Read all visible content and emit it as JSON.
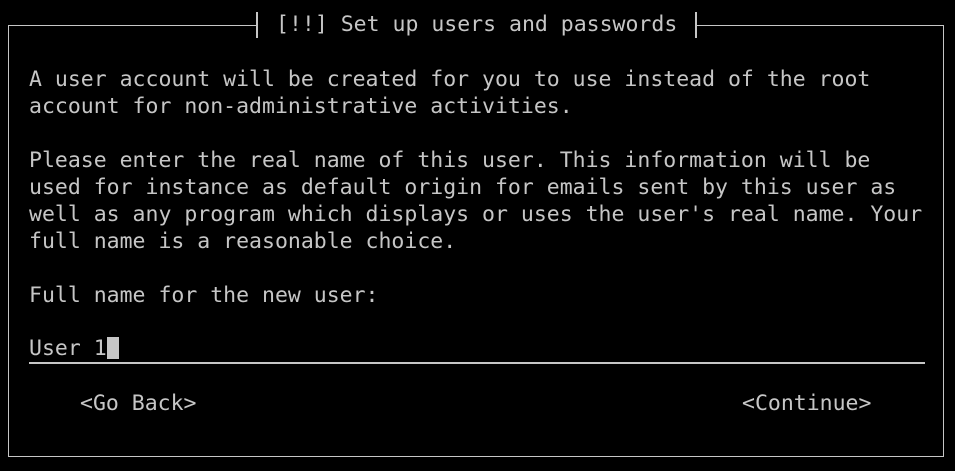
{
  "dialog": {
    "title": "[!!] Set up users and passwords",
    "paragraphs": [
      "A user account will be created for you to use instead of the root",
      "account for non-administrative activities.",
      "Please enter the real name of this user. This information will be",
      "used for instance as default origin for emails sent by this user as",
      "well as any program which displays or uses the user's real name. Your",
      "full name is a reasonable choice."
    ],
    "prompt": "Full name for the new user:",
    "input_value": "User 1"
  },
  "buttons": {
    "back": "<Go Back>",
    "continue": "<Continue>"
  }
}
